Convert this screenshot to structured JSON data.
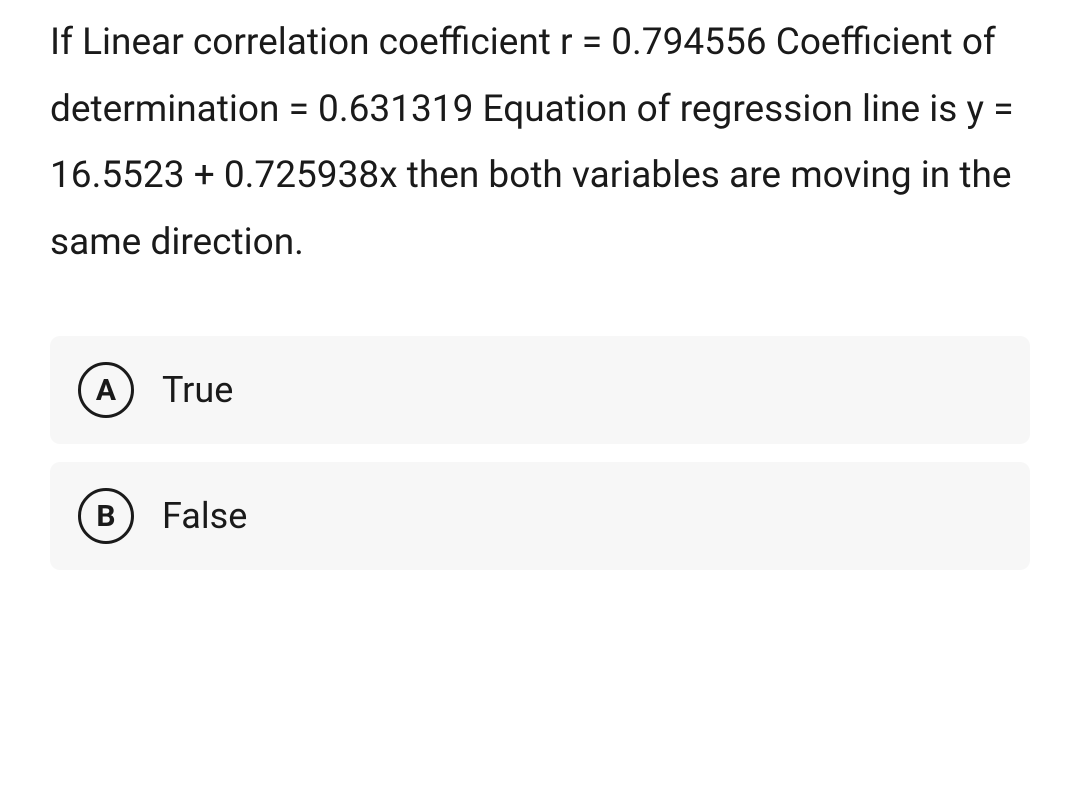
{
  "question": {
    "text": "If Linear correlation coefficient r = 0.794556 Coefficient of determination = 0.631319 Equation of regression line is y = 16.5523 + 0.725938x then both variables are moving in the same direction."
  },
  "options": [
    {
      "letter": "A",
      "label": "True"
    },
    {
      "letter": "B",
      "label": "False"
    }
  ]
}
